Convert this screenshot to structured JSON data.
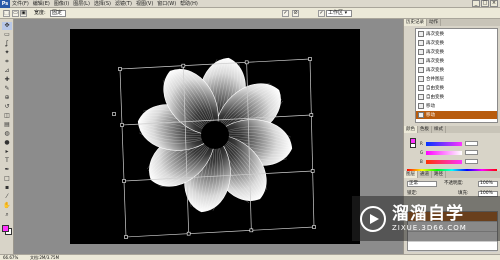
{
  "menubar": {
    "app_logo": "Ps",
    "items": [
      "文件(F)",
      "编辑(E)",
      "图像(I)",
      "图层(L)",
      "选择(S)",
      "滤镜(T)",
      "视图(V)",
      "窗口(W)",
      "帮助(H)"
    ],
    "window_controls": [
      "_",
      "□",
      "×"
    ]
  },
  "options": {
    "mode_label": "宽度:",
    "mode_value": "固定",
    "workspace_label": "工作区 ▾"
  },
  "toolbox": {
    "tools": [
      "move-tool-icon",
      "marquee-tool-icon",
      "lasso-tool-icon",
      "magic-wand-icon",
      "crop-tool-icon",
      "slice-tool-icon",
      "healing-brush-icon",
      "brush-tool-icon",
      "stamp-tool-icon",
      "history-brush-icon",
      "eraser-tool-icon",
      "gradient-tool-icon",
      "blur-tool-icon",
      "dodge-tool-icon",
      "path-select-icon",
      "type-tool-icon",
      "pen-tool-icon",
      "shape-tool-icon",
      "notes-tool-icon",
      "eyedropper-icon",
      "hand-tool-icon",
      "zoom-tool-icon"
    ],
    "tool_glyphs": [
      "✥",
      "▭",
      "ʆ",
      "✦",
      "⌗",
      "⊿",
      "✚",
      "✎",
      "⊕",
      "↺",
      "◫",
      "▤",
      "◍",
      "●",
      "▸",
      "T",
      "✒",
      "□",
      "▪",
      "⁄",
      "✋",
      "⌕"
    ],
    "foreground_color": "#ff33ff",
    "background_color": "#ffffff"
  },
  "history_panel": {
    "tabs": [
      "历史记录",
      "动作"
    ],
    "rows": [
      "再次变换",
      "再次变换",
      "再次变换",
      "再次变换",
      "再次变换",
      "合并图层",
      "自由变换",
      "自由变换",
      "移动",
      "移动"
    ],
    "selected_index": 9,
    "selected_color": "#b85c0e"
  },
  "color_panel": {
    "tabs": [
      "颜色",
      "色板",
      "样式"
    ],
    "channel_labels": [
      "R",
      "G",
      "B"
    ],
    "channel_values": [
      "",
      "",
      ""
    ],
    "foreground_chip": "#ff33ff",
    "background_chip": "#ffffff"
  },
  "layers_panel": {
    "tabs": [
      "图层",
      "通道",
      "路径"
    ],
    "blend_mode": "正常",
    "opacity_label": "不透明度:",
    "opacity_value": "100%",
    "lock_label": "锁定:",
    "fill_label": "填充:",
    "fill_value": "100%",
    "rows": 4,
    "selected_index": 0
  },
  "statusbar": {
    "zoom": "66.67%",
    "doc_info": "文档:2M/3.75M"
  },
  "watermark": {
    "title": "溜溜自学",
    "url": "ZIXUE.3D66.COM"
  },
  "artwork": {
    "petal_color": "#ffffff",
    "background": "#000000",
    "petal_count": 8
  }
}
